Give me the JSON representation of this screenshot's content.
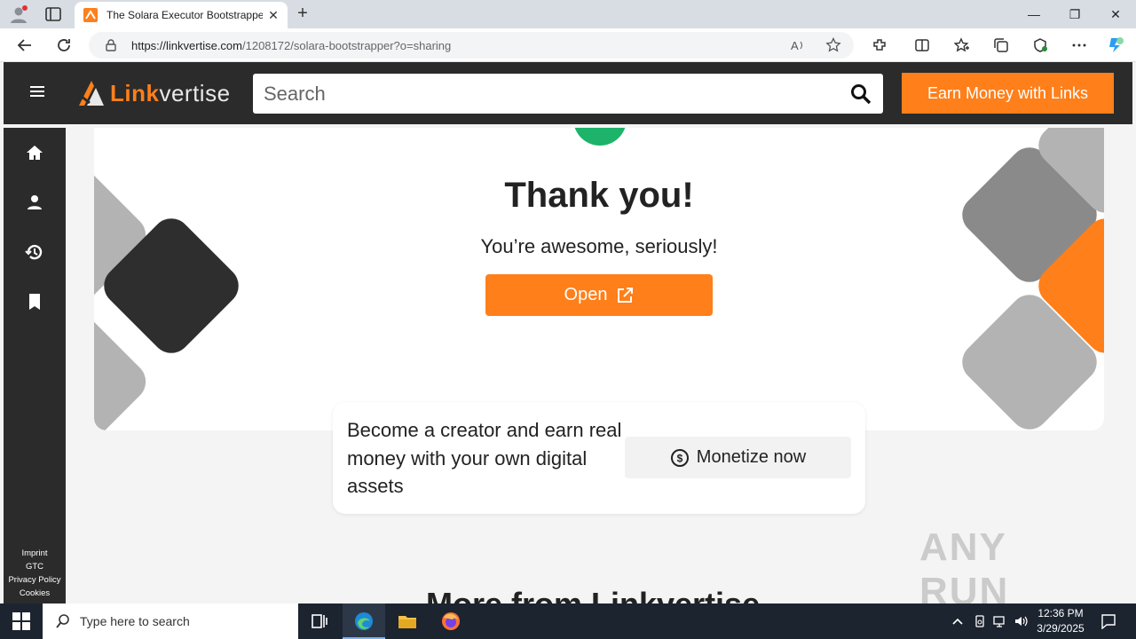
{
  "browser": {
    "tab_title": "The Solara Executor Bootstrapper",
    "url_host": "https://linkvertise.com",
    "url_path": "/1208172/solara-bootstrapper?o=sharing"
  },
  "header": {
    "logo_part1": "Link",
    "logo_part2": "vertise",
    "search_placeholder": "Search",
    "earn_button": "Earn Money with Links"
  },
  "sidebar": {
    "links": [
      "Imprint",
      "GTC",
      "Privacy Policy",
      "Cookies"
    ]
  },
  "card": {
    "title": "Thank you!",
    "subtitle": "You’re awesome, seriously!",
    "open_button": "Open"
  },
  "creator": {
    "text": "Become a creator and earn real money with your own digital assets",
    "button": "Monetize now"
  },
  "more_section_title": "More from Linkvertise",
  "watermark": "ANY RUN",
  "taskbar": {
    "search_placeholder": "Type here to search",
    "time": "12:36 PM",
    "date": "3/29/2025"
  },
  "colors": {
    "brand_orange": "#ff7f1a",
    "header_dark": "#2b2b2b",
    "success_green": "#1db36a"
  }
}
